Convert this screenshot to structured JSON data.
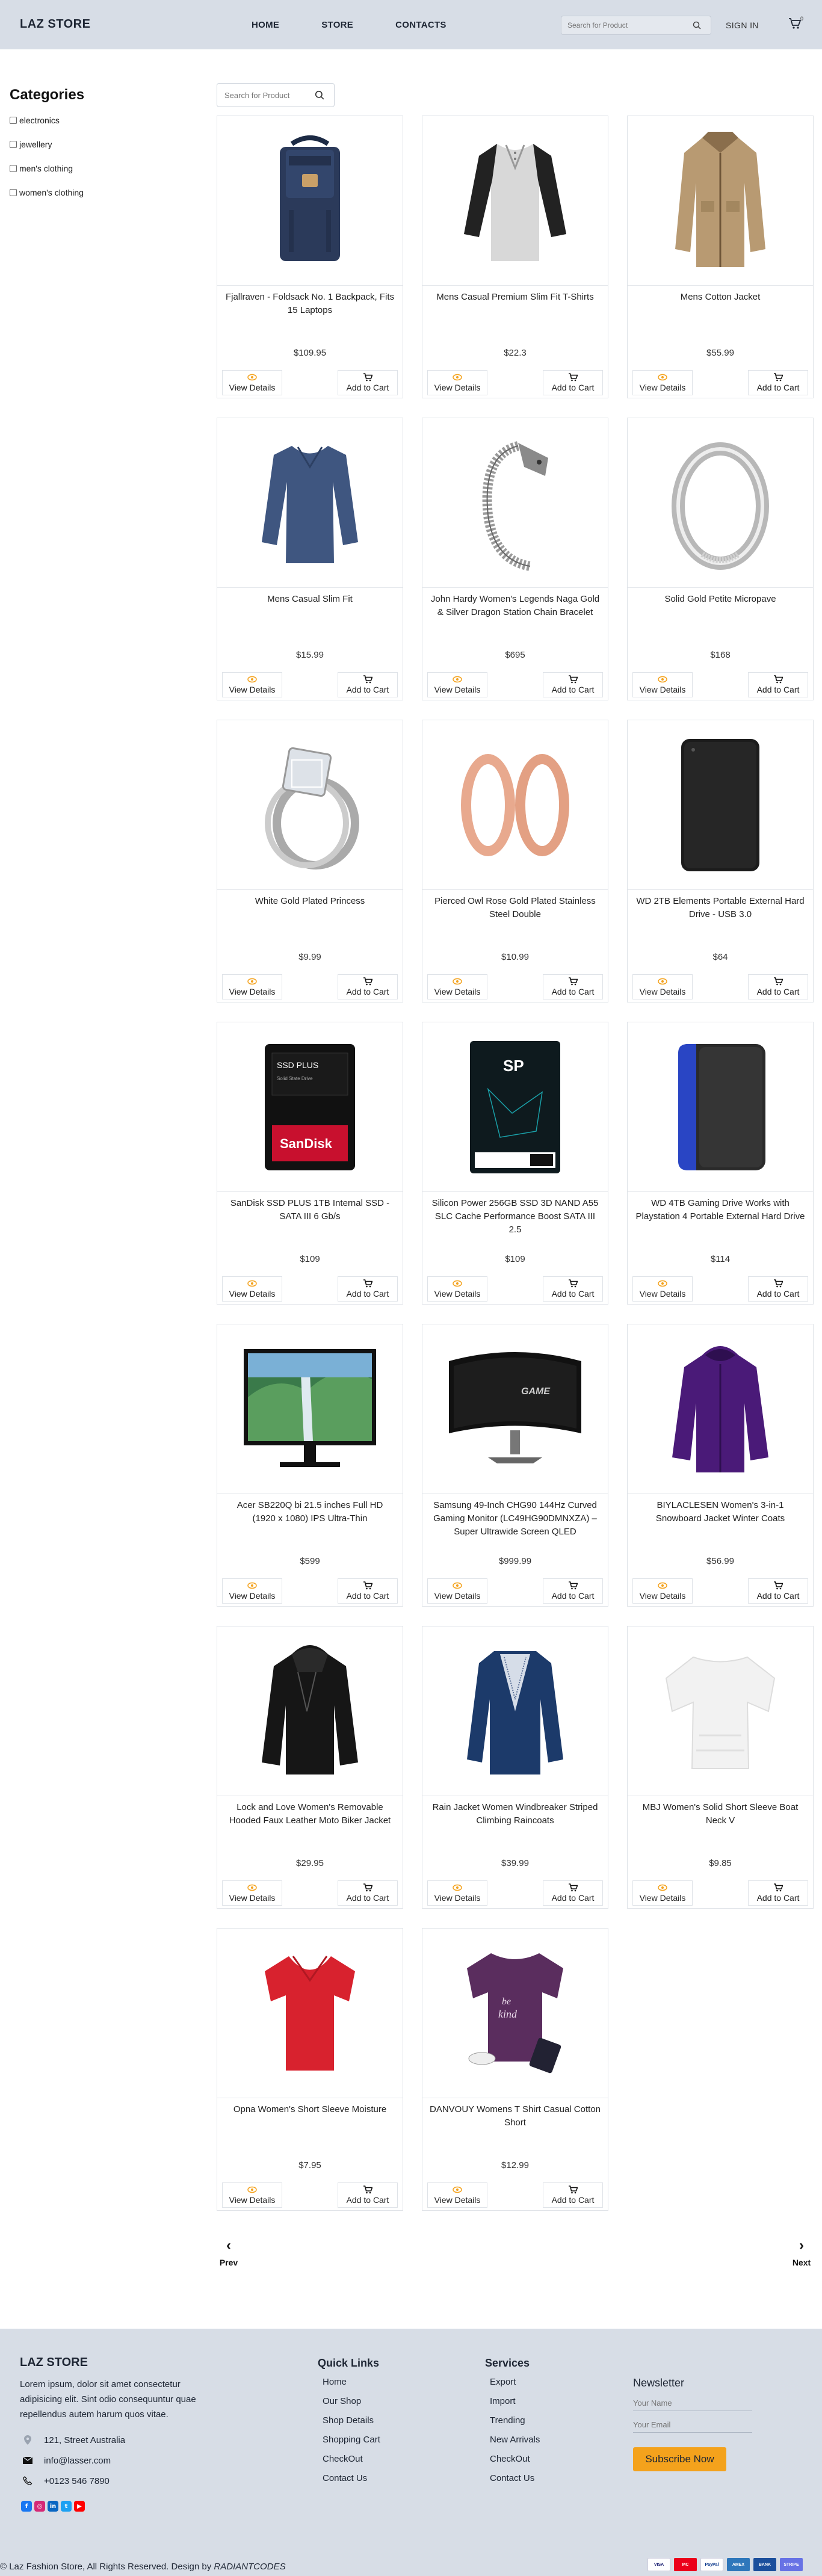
{
  "header": {
    "brand": "LAZ STORE",
    "nav": [
      "HOME",
      "STORE",
      "CONTACTS"
    ],
    "search_placeholder": "Search for Product",
    "signin": "SIGN IN",
    "cart_count": "0"
  },
  "sidebar": {
    "title": "Categories",
    "categories": [
      "electronics",
      "jewellery",
      "men's clothing",
      "women's clothing"
    ]
  },
  "products_search_placeholder": "Search for Product",
  "products": [
    {
      "title": "Fjallraven - Foldsack No. 1 Backpack, Fits 15 Laptops",
      "price": "$109.95",
      "image": "backpack"
    },
    {
      "title": "Mens Casual Premium Slim Fit T-Shirts",
      "price": "$22.3",
      "image": "raglan-tee"
    },
    {
      "title": "Mens Cotton Jacket",
      "price": "$55.99",
      "image": "beige-jacket"
    },
    {
      "title": "Mens Casual Slim Fit",
      "price": "$15.99",
      "image": "blue-longsleeve"
    },
    {
      "title": "John Hardy Women's Legends Naga Gold & Silver Dragon Station Chain Bracelet",
      "price": "$695",
      "image": "dragon-bracelet"
    },
    {
      "title": "Solid Gold Petite Micropave",
      "price": "$168",
      "image": "silver-ring"
    },
    {
      "title": "White Gold Plated Princess",
      "price": "$9.99",
      "image": "diamond-ring"
    },
    {
      "title": "Pierced Owl Rose Gold Plated Stainless Steel Double",
      "price": "$10.99",
      "image": "rose-earrings"
    },
    {
      "title": "WD 2TB Elements Portable External Hard Drive - USB 3.0",
      "price": "$64",
      "image": "black-hdd"
    },
    {
      "title": "SanDisk SSD PLUS 1TB Internal SSD - SATA III 6 Gb/s",
      "price": "$109",
      "image": "sandisk-ssd"
    },
    {
      "title": "Silicon Power 256GB SSD 3D NAND A55 SLC Cache Performance Boost SATA III 2.5",
      "price": "$109",
      "image": "sp-ssd"
    },
    {
      "title": "WD 4TB Gaming Drive Works with Playstation 4 Portable External Hard Drive",
      "price": "$114",
      "image": "blue-hdd"
    },
    {
      "title": "Acer SB220Q bi 21.5 inches Full HD (1920 x 1080) IPS Ultra-Thin",
      "price": "$599",
      "image": "acer-monitor"
    },
    {
      "title": "Samsung 49-Inch CHG90 144Hz Curved Gaming Monitor (LC49HG90DMNXZA) – Super Ultrawide Screen QLED",
      "price": "$999.99",
      "image": "curved-monitor"
    },
    {
      "title": "BIYLACLESEN Women's 3-in-1 Snowboard Jacket Winter Coats",
      "price": "$56.99",
      "image": "purple-jacket"
    },
    {
      "title": "Lock and Love Women's Removable Hooded Faux Leather Moto Biker Jacket",
      "price": "$29.95",
      "image": "leather-jacket"
    },
    {
      "title": "Rain Jacket Women Windbreaker Striped Climbing Raincoats",
      "price": "$39.99",
      "image": "navy-raincoat"
    },
    {
      "title": "MBJ Women's Solid Short Sleeve Boat Neck V",
      "price": "$9.85",
      "image": "white-top"
    },
    {
      "title": "Opna Women's Short Sleeve Moisture",
      "price": "$7.95",
      "image": "red-tee"
    },
    {
      "title": "DANVOUY Womens T Shirt Casual Cotton Short",
      "price": "$12.99",
      "image": "purple-tee"
    }
  ],
  "buttons": {
    "view": "View Details",
    "cart": "Add to Cart"
  },
  "pager": {
    "prev": "Prev",
    "next": "Next"
  },
  "footer": {
    "brand": "LAZ STORE",
    "description": "Lorem ipsum, dolor sit amet consectetur adipisicing elit. Sint odio consequuntur quae repellendus autem harum quos vitae.",
    "address": "121, Street Australia",
    "email": "info@lasser.com",
    "phone": "+0123 546 7890",
    "quick_links": {
      "title": "Quick Links",
      "items": [
        "Home",
        "Our Shop",
        "Shop Details",
        "Shopping Cart",
        "CheckOut",
        "Contact Us"
      ]
    },
    "services": {
      "title": "Services",
      "items": [
        "Export",
        "Import",
        "Trending",
        "New Arrivals",
        "CheckOut",
        "Contact Us"
      ]
    },
    "newsletter": {
      "title": "Newsletter",
      "name_placeholder": "Your Name",
      "email_placeholder": "Your Email",
      "button": "Subscribe Now"
    },
    "copyright": "© Laz Fashion Store, All Rights Reserved. Design by",
    "designer": "RADIANTCODES",
    "payments": [
      "VISA",
      "MC",
      "PayPal",
      "AMEX",
      "BANK",
      "STRIPE"
    ]
  },
  "colors": {
    "header_bg": "#d7dde6",
    "accent": "#f4a21c",
    "brand_text": "#1d2533"
  }
}
